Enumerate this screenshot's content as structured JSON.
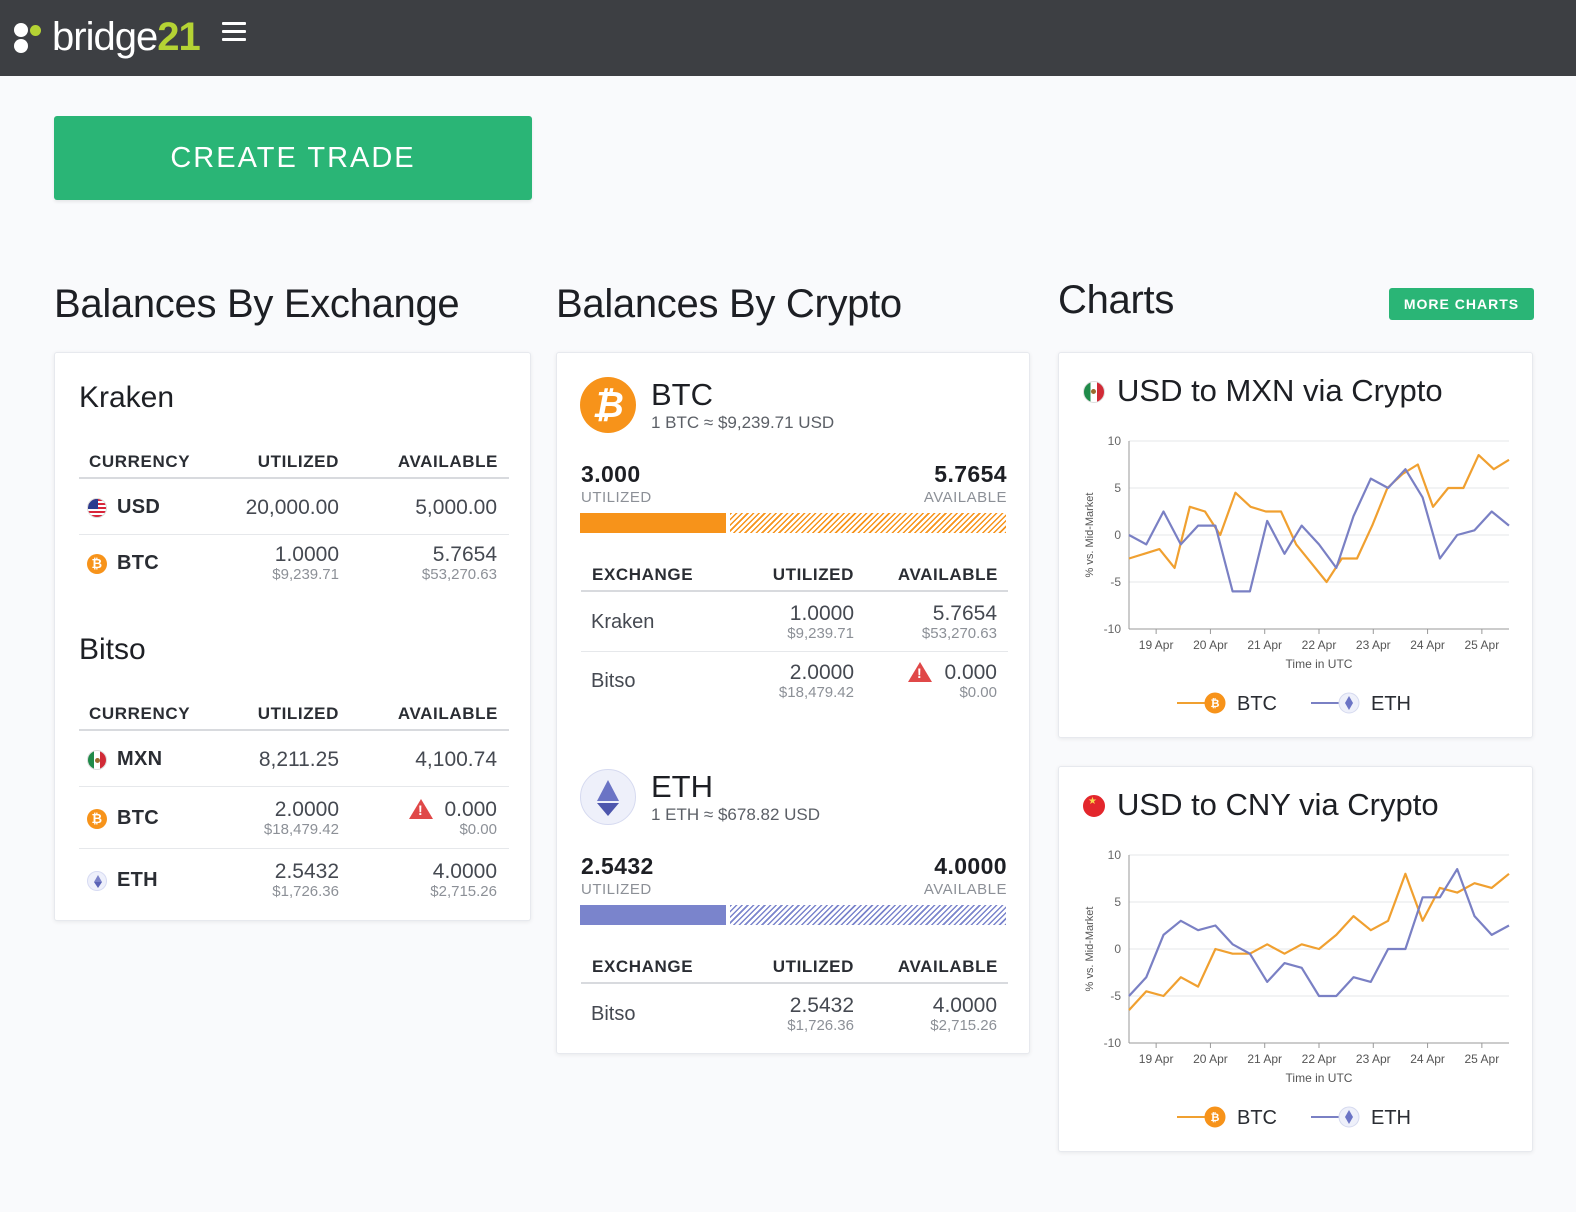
{
  "app": {
    "brand_word": "bridge",
    "brand_number": "21",
    "menu_icon": "hamburger-icon"
  },
  "actions": {
    "create_trade": "CREATE TRADE",
    "more_charts": "MORE CHARTS"
  },
  "sections": {
    "by_exchange": "Balances By Exchange",
    "by_crypto": "Balances By Crypto",
    "charts": "Charts"
  },
  "exchanges": [
    {
      "name": "Kraken",
      "headers": [
        "CURRENCY",
        "UTILIZED",
        "AVAILABLE"
      ],
      "rows": [
        {
          "currency": "USD",
          "icon": "us-flag-icon",
          "utilized": "20,000.00",
          "utilized_usd": "",
          "available": "5,000.00",
          "available_usd": "",
          "warning": false
        },
        {
          "currency": "BTC",
          "icon": "bitcoin-icon",
          "utilized": "1.0000",
          "utilized_usd": "$9,239.71",
          "available": "5.7654",
          "available_usd": "$53,270.63",
          "warning": false
        }
      ]
    },
    {
      "name": "Bitso",
      "headers": [
        "CURRENCY",
        "UTILIZED",
        "AVAILABLE"
      ],
      "rows": [
        {
          "currency": "MXN",
          "icon": "mx-flag-icon",
          "utilized": "8,211.25",
          "utilized_usd": "",
          "available": "4,100.74",
          "available_usd": "",
          "warning": false
        },
        {
          "currency": "BTC",
          "icon": "bitcoin-icon",
          "utilized": "2.0000",
          "utilized_usd": "$18,479.42",
          "available": "0.000",
          "available_usd": "$0.00",
          "warning": true
        },
        {
          "currency": "ETH",
          "icon": "ethereum-icon",
          "utilized": "2.5432",
          "utilized_usd": "$1,726.36",
          "available": "4.0000",
          "available_usd": "$2,715.26",
          "warning": false
        }
      ]
    }
  ],
  "cryptos": [
    {
      "symbol": "BTC",
      "rate": "1 BTC ≈ $9,239.71 USD",
      "utilized": "3.000",
      "utilized_label": "UTILIZED",
      "available": "5.7654",
      "available_label": "AVAILABLE",
      "utilized_fraction": 0.342,
      "color": "#f7931a",
      "headers": [
        "EXCHANGE",
        "UTILIZED",
        "AVAILABLE"
      ],
      "rows": [
        {
          "exchange": "Kraken",
          "utilized": "1.0000",
          "utilized_usd": "$9,239.71",
          "available": "5.7654",
          "available_usd": "$53,270.63",
          "warning": false
        },
        {
          "exchange": "Bitso",
          "utilized": "2.0000",
          "utilized_usd": "$18,479.42",
          "available": "0.000",
          "available_usd": "$0.00",
          "warning": true
        }
      ]
    },
    {
      "symbol": "ETH",
      "rate": "1 ETH ≈ $678.82 USD",
      "utilized": "2.5432",
      "utilized_label": "UTILIZED",
      "available": "4.0000",
      "available_label": "AVAILABLE",
      "utilized_fraction": 0.342,
      "color": "#7a84cc",
      "headers": [
        "EXCHANGE",
        "UTILIZED",
        "AVAILABLE"
      ],
      "rows": [
        {
          "exchange": "Bitso",
          "utilized": "2.5432",
          "utilized_usd": "$1,726.36",
          "available": "4.0000",
          "available_usd": "$2,715.26",
          "warning": false
        }
      ]
    }
  ],
  "chart_data": [
    {
      "type": "line",
      "title": "USD to MXN via Crypto",
      "flag": "mx-flag-icon",
      "xlabel": "Time in UTC",
      "ylabel": "% vs. Mid-Market",
      "ylim": [
        -10,
        10
      ],
      "yticks": [
        "10",
        "5",
        "0",
        "-5",
        "-10"
      ],
      "categories": [
        "19 Apr",
        "20 Apr",
        "21 Apr",
        "22 Apr",
        "23 Apr",
        "24 Apr",
        "25 Apr"
      ],
      "legend": "bottom",
      "grid": true,
      "series": [
        {
          "name": "BTC",
          "color": "#f0a030",
          "values": [
            -2.5,
            -2,
            -1.5,
            -3.5,
            3,
            2.5,
            0,
            4.5,
            3,
            2.5,
            2.5,
            -1,
            -3,
            -5,
            -2.5,
            -2.5,
            1,
            5,
            6.5,
            7.5,
            3,
            5,
            5,
            8.5,
            7,
            8
          ]
        },
        {
          "name": "ETH",
          "color": "#7a80c4",
          "values": [
            0,
            -1,
            2.5,
            -1,
            1,
            1,
            -6,
            -6,
            1.5,
            -2,
            1,
            -1,
            -3.5,
            2,
            6,
            5,
            7,
            4,
            -2.5,
            0,
            0.5,
            2.5,
            1
          ]
        }
      ]
    },
    {
      "type": "line",
      "title": "USD to CNY via Crypto",
      "flag": "cn-flag-icon",
      "xlabel": "Time in UTC",
      "ylabel": "% vs. Mid-Market",
      "ylim": [
        -10,
        10
      ],
      "yticks": [
        "10",
        "5",
        "0",
        "-5",
        "-10"
      ],
      "categories": [
        "19 Apr",
        "20 Apr",
        "21 Apr",
        "22 Apr",
        "23 Apr",
        "24 Apr",
        "25 Apr"
      ],
      "legend": "bottom",
      "grid": true,
      "series": [
        {
          "name": "BTC",
          "color": "#f0a030",
          "values": [
            -6.5,
            -4.5,
            -5,
            -3,
            -4,
            0,
            -0.5,
            -0.5,
            0.5,
            -0.5,
            0.5,
            0,
            1.5,
            3.5,
            2,
            3,
            8,
            3,
            6.5,
            6,
            7,
            6.5,
            8
          ]
        },
        {
          "name": "ETH",
          "color": "#7a80c4",
          "values": [
            -5,
            -3,
            1.5,
            3,
            2,
            2.5,
            0.5,
            -0.5,
            -3.5,
            -1.5,
            -2,
            -5,
            -5,
            -3,
            -3.5,
            0,
            0,
            5.5,
            5.5,
            8.5,
            3.5,
            1.5,
            2.5
          ]
        }
      ]
    }
  ]
}
